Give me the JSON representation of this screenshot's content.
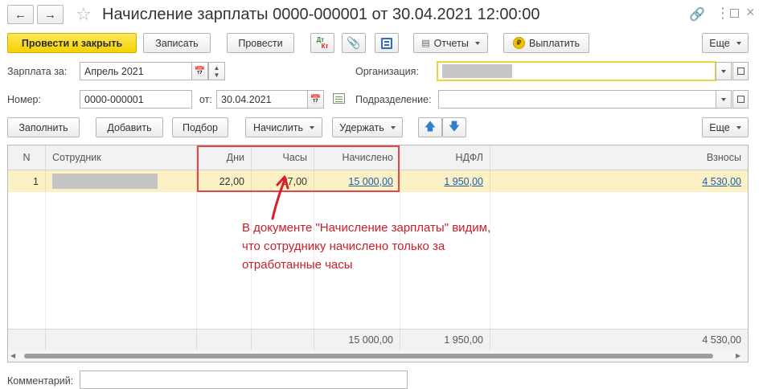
{
  "window": {
    "title": "Начисление зарплаты 0000-000001 от 30.04.2021 12:00:00",
    "back_icon": "arrow-left-icon",
    "forward_icon": "arrow-right-icon",
    "star_icon": "star-icon"
  },
  "toolbar": {
    "post_close": "Провести и закрыть",
    "save": "Записать",
    "post": "Провести",
    "dt_kt_top": "Дт",
    "dt_kt_bottom": "Кт",
    "reports": "Отчеты",
    "pay": "Выплатить",
    "pay_coin": "₽",
    "more": "Еще"
  },
  "form": {
    "salary_for_label": "Зарплата за:",
    "salary_for_value": "Апрель 2021",
    "organization_label": "Организация:",
    "number_label": "Номер:",
    "number_value": "0000-000001",
    "date_label": "от:",
    "date_value": "30.04.2021",
    "department_label": "Подразделение:",
    "department_value": "",
    "comment_label": "Комментарий:",
    "comment_value": ""
  },
  "table_toolbar": {
    "fill": "Заполнить",
    "add": "Добавить",
    "select": "Подбор",
    "accrue": "Начислить",
    "withhold": "Удержать",
    "more": "Еще"
  },
  "table": {
    "headers": {
      "n": "N",
      "employee": "Сотрудник",
      "days": "Дни",
      "hours": "Часы",
      "accrued": "Начислено",
      "ndfl": "НДФЛ",
      "contributions": "Взносы"
    },
    "rows": [
      {
        "n": "1",
        "employee": "",
        "days": "22,00",
        "hours": "87,00",
        "accrued": "15 000,00",
        "ndfl": "1 950,00",
        "contributions": "4 530,00"
      }
    ],
    "totals": {
      "accrued": "15 000,00",
      "ndfl": "1 950,00",
      "contributions": "4 530,00"
    }
  },
  "annotation": {
    "line1": "В документе \"Начисление зарплаты\" видим,",
    "line2": "что сотруднику начислено только за",
    "line3": "отработанные часы"
  },
  "colors": {
    "primary_button": "#f5d000",
    "selected_row": "#fbf1c4",
    "annotation_red": "#c8202a",
    "link": "#1d5fa8"
  }
}
